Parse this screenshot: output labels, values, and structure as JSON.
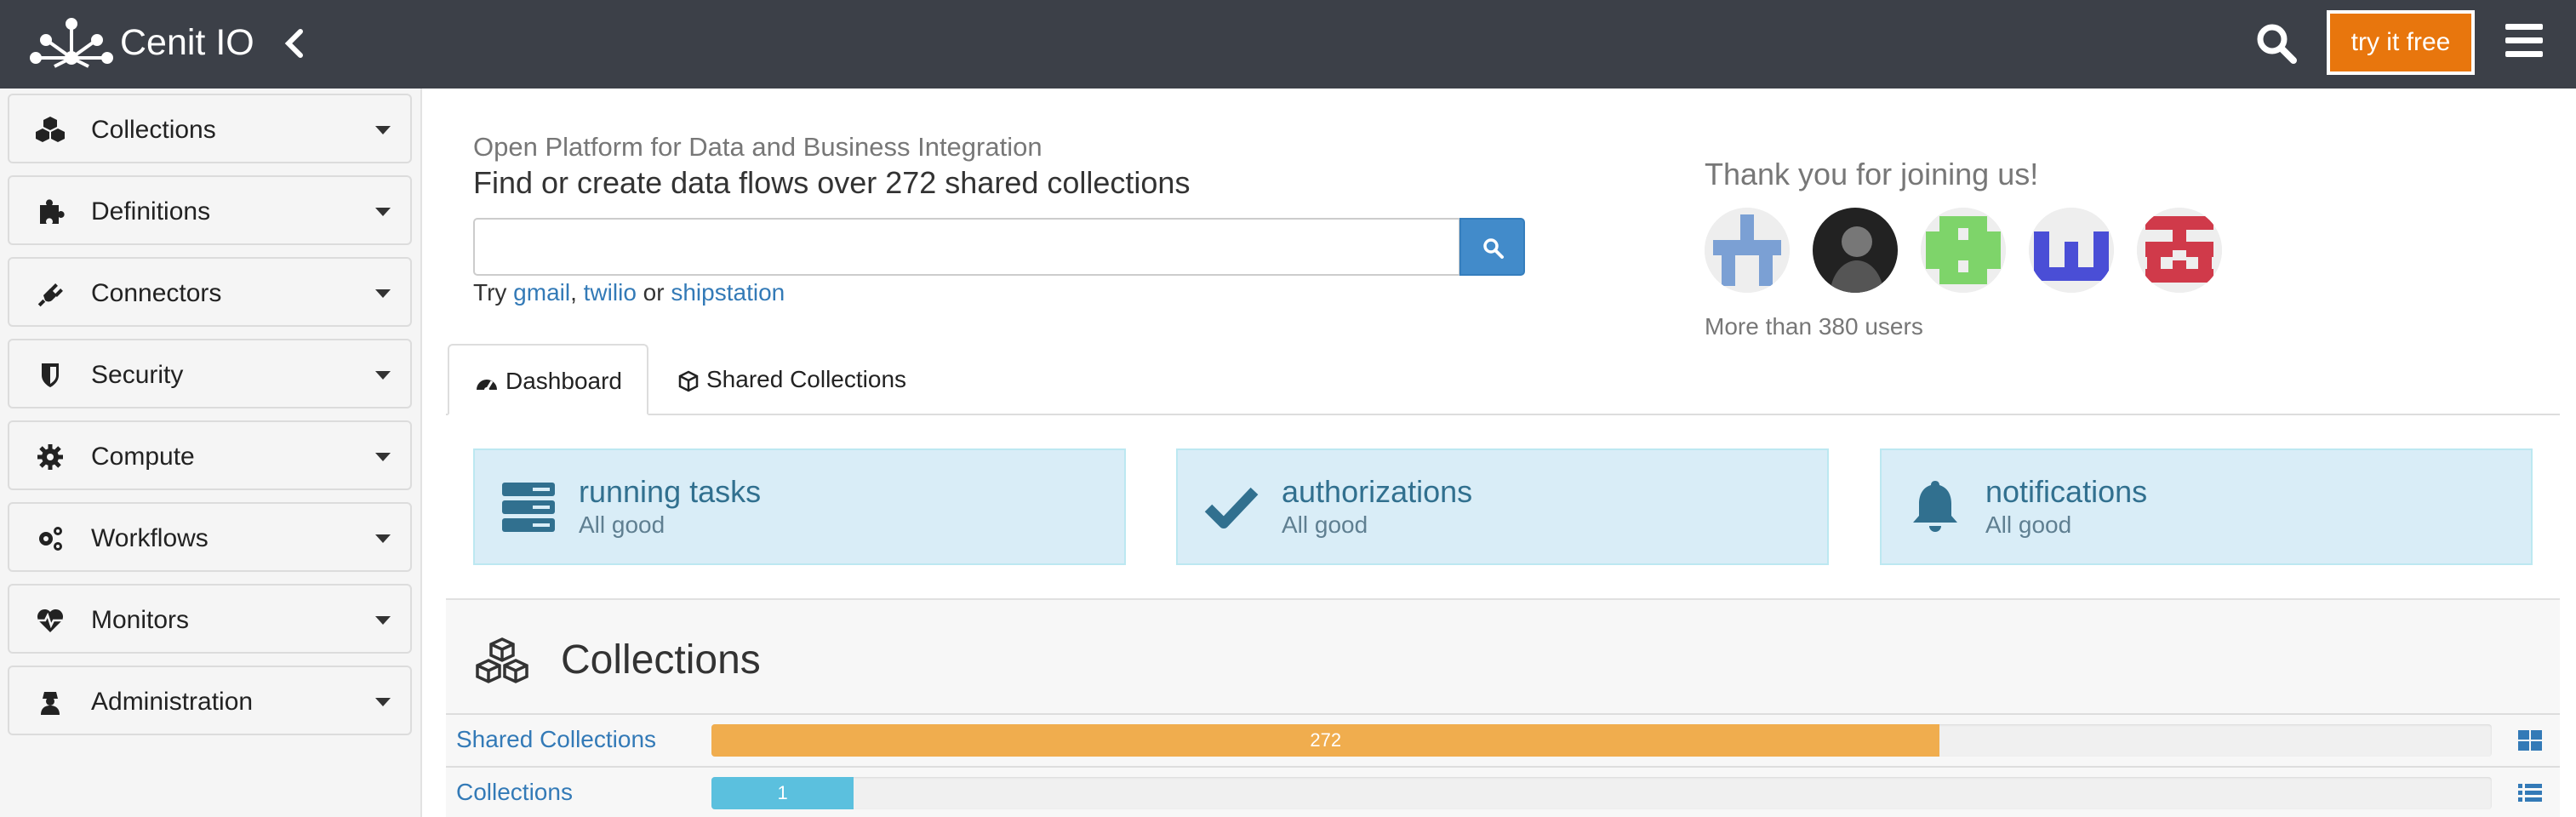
{
  "header": {
    "brand": "Cenit IO",
    "try_free": "try it free"
  },
  "sidebar": {
    "items": [
      {
        "label": "Collections",
        "icon": "cubes-icon"
      },
      {
        "label": "Definitions",
        "icon": "puzzle-icon"
      },
      {
        "label": "Connectors",
        "icon": "plug-icon"
      },
      {
        "label": "Security",
        "icon": "shield-icon"
      },
      {
        "label": "Compute",
        "icon": "gear-icon"
      },
      {
        "label": "Workflows",
        "icon": "gears-icon"
      },
      {
        "label": "Monitors",
        "icon": "heartbeat-icon"
      },
      {
        "label": "Administration",
        "icon": "user-secret-icon"
      }
    ]
  },
  "hero": {
    "tagline": "Open Platform for Data and Business Integration",
    "headline": "Find or create data flows over 272 shared collections",
    "search_value": "",
    "try_prefix": "Try",
    "suggestions": [
      "gmail",
      "twilio",
      "shipstation"
    ],
    "sep1": ",",
    "sep2": "or"
  },
  "community": {
    "title": "Thank you for joining us!",
    "users_count": "More than 380 users",
    "avatar_colors": [
      "#7ba0d4",
      "#222222",
      "#7ed46a",
      "#4a4ed6",
      "#d03a4a"
    ]
  },
  "tabs": [
    {
      "label": "Dashboard",
      "icon": "dashboard-icon",
      "active": true
    },
    {
      "label": "Shared Collections",
      "icon": "cube-icon",
      "active": false
    }
  ],
  "status": [
    {
      "title": "running tasks",
      "subtitle": "All good",
      "icon": "tasks-icon"
    },
    {
      "title": "authorizations",
      "subtitle": "All good",
      "icon": "check-icon"
    },
    {
      "title": "notifications",
      "subtitle": "All good",
      "icon": "bell-icon"
    }
  ],
  "collections_panel": {
    "title": "Collections",
    "rows": [
      {
        "label": "Shared Collections",
        "value": "272",
        "fill_percent": 69,
        "color": "#f0ad4e",
        "icon": "grid-icon"
      },
      {
        "label": "Collections",
        "value": "1",
        "fill_percent": 8,
        "color": "#5bc0de",
        "icon": "list-icon"
      }
    ]
  },
  "colors": {
    "topbar": "#3c4048",
    "accent": "#e8760d",
    "link": "#337ab7",
    "info_bg": "#d9edf7"
  }
}
